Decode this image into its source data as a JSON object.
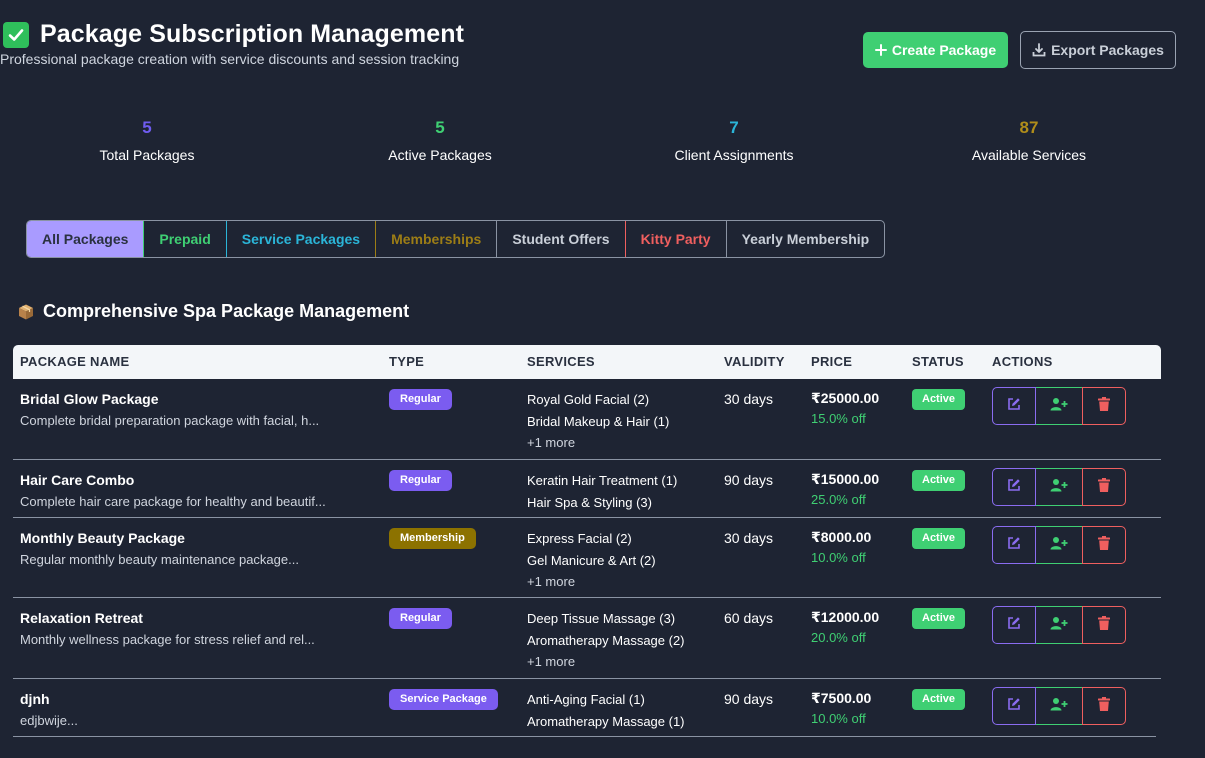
{
  "header": {
    "title": "Package Subscription Management",
    "subtitle": "Professional package creation with service discounts and session tracking",
    "create_label": "Create Package",
    "export_label": "Export Packages"
  },
  "stats": [
    {
      "value": "5",
      "label": "Total Packages",
      "color": "#6f5cf0"
    },
    {
      "value": "5",
      "label": "Active Packages",
      "color": "#3fcf73"
    },
    {
      "value": "7",
      "label": "Client Assignments",
      "color": "#2bb5d8"
    },
    {
      "value": "87",
      "label": "Available Services",
      "color": "#b08d1a"
    }
  ],
  "tabs": [
    {
      "label": "All Packages",
      "color": "#2a3140",
      "bg": "#a99bff",
      "active": true
    },
    {
      "label": "Prepaid",
      "color": "#3fcf73",
      "bg": "transparent"
    },
    {
      "label": "Service Packages",
      "color": "#2bb5d8",
      "bg": "transparent"
    },
    {
      "label": "Memberships",
      "color": "#9c7d16",
      "bg": "transparent"
    },
    {
      "label": "Student Offers",
      "color": "#c9cfd8",
      "bg": "transparent"
    },
    {
      "label": "Kitty Party",
      "color": "#ef5f5f",
      "bg": "transparent"
    },
    {
      "label": "Yearly Membership",
      "color": "#c9cfd8",
      "bg": "transparent"
    }
  ],
  "section": {
    "title": "Comprehensive Spa Package Management"
  },
  "table": {
    "headers": [
      "PACKAGE NAME",
      "TYPE",
      "SERVICES",
      "VALIDITY",
      "PRICE",
      "STATUS",
      "ACTIONS"
    ],
    "rows": [
      {
        "name": "Bridal Glow Package",
        "desc": "Complete bridal preparation package with facial, h...",
        "type": "Regular",
        "type_color": "#7b5cf0",
        "services": [
          "Royal Gold Facial (2)",
          "Bridal Makeup & Hair (1)"
        ],
        "more": "+1 more",
        "validity": "30 days",
        "price": "₹25000.00",
        "discount": "15.0% off",
        "status": "Active"
      },
      {
        "name": "Hair Care Combo",
        "desc": "Complete hair care package for healthy and beautif...",
        "type": "Regular",
        "type_color": "#7b5cf0",
        "services": [
          "Keratin Hair Treatment (1)",
          "Hair Spa & Styling (3)"
        ],
        "more": "",
        "validity": "90 days",
        "price": "₹15000.00",
        "discount": "25.0% off",
        "status": "Active"
      },
      {
        "name": "Monthly Beauty Package",
        "desc": "Regular monthly beauty maintenance package...",
        "type": "Membership",
        "type_color": "#8c7200",
        "services": [
          "Express Facial (2)",
          "Gel Manicure & Art (2)"
        ],
        "more": "+1 more",
        "validity": "30 days",
        "price": "₹8000.00",
        "discount": "10.0% off",
        "status": "Active"
      },
      {
        "name": "Relaxation Retreat",
        "desc": "Monthly wellness package for stress relief and rel...",
        "type": "Regular",
        "type_color": "#7b5cf0",
        "services": [
          "Deep Tissue Massage (3)",
          "Aromatherapy Massage (2)"
        ],
        "more": "+1 more",
        "validity": "60 days",
        "price": "₹12000.00",
        "discount": "20.0% off",
        "status": "Active"
      },
      {
        "name": "djnh",
        "desc": "edjbwije...",
        "type": "Service Package",
        "type_color": "#7b5cf0",
        "services": [
          "Anti-Aging Facial (1)",
          "Aromatherapy Massage (1)"
        ],
        "more": "",
        "validity": "90 days",
        "price": "₹7500.00",
        "discount": "10.0% off",
        "status": "Active"
      }
    ]
  },
  "icons": {
    "title": "check-box-icon",
    "create": "plus-icon",
    "export": "download-icon",
    "section": "package-box-icon",
    "edit": "edit-icon",
    "assign": "user-plus-icon",
    "delete": "trash-icon"
  }
}
